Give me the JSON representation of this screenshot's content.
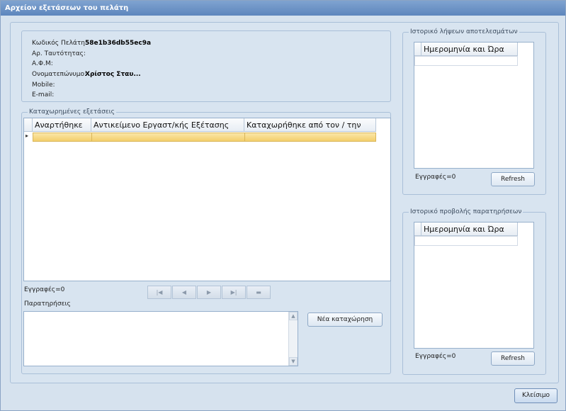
{
  "window": {
    "title": "Αρχείον εξετάσεων του πελάτη"
  },
  "client_info": {
    "rows": [
      {
        "label": "Κωδικός Πελάτη:",
        "value": "58e1b36db55ec9a"
      },
      {
        "label": "Αρ. Ταυτότητας:",
        "value": ""
      },
      {
        "label": "Α.Φ.Μ:",
        "value": ""
      },
      {
        "label": "Ονοματεπώνυμο:",
        "value": "Χρίστος Σταυ..."
      },
      {
        "label": "Mobile:",
        "value": ""
      },
      {
        "label": "E-mail:",
        "value": ""
      }
    ]
  },
  "exams": {
    "title": "Καταχωρημένες εξετάσεις",
    "columns": [
      "Αναρτήθηκε",
      "Αντικείμενο Εργαστ/κής Εξέτασης",
      "Καταχωρήθηκε από τον / την"
    ],
    "row_indicator": "▸",
    "records_label": "Εγγραφές=0"
  },
  "navigator": {
    "first": "|◀",
    "prev": "◀",
    "next": "▶",
    "last": "▶|",
    "delete": "▬"
  },
  "notes": {
    "label": "Παρατηρήσεις",
    "value": ""
  },
  "new_entry_button": "Νέα καταχώρηση",
  "results_history": {
    "title": "Ιστορικό λήψεων αποτελεσμάτων",
    "column": "Ημερομηνία και Ώρα",
    "records_label": "Εγγραφές=0",
    "refresh_label": "Refresh"
  },
  "observations_history": {
    "title": "Ιστορικό προβολής παρατηρήσεων",
    "column": "Ημερομηνία και Ώρα",
    "records_label": "Εγγραφές=0",
    "refresh_label": "Refresh"
  },
  "close_button": "Κλείσιμο",
  "colors": {
    "selected_row": "#f6d57a",
    "title_bar": "#5d86bd"
  }
}
